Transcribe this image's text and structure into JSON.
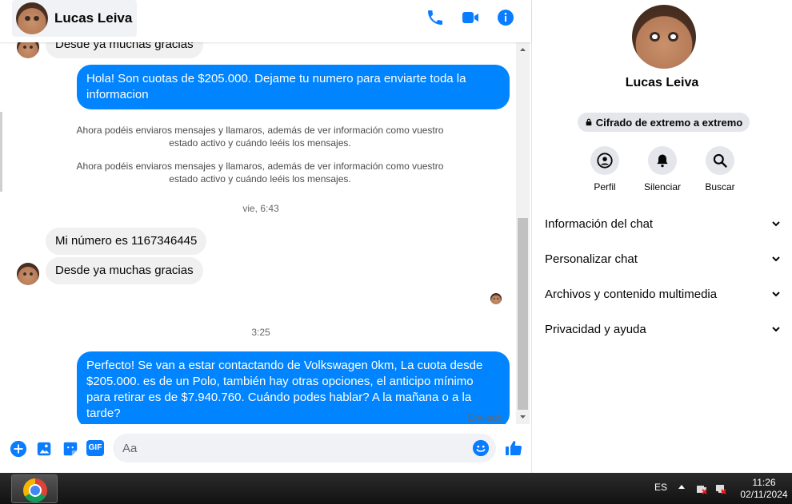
{
  "contact": {
    "name": "Lucas Leiva"
  },
  "header": {
    "icons": [
      "phone-icon",
      "video-call-icon",
      "info-icon"
    ]
  },
  "messages": {
    "partial_top": "Desde ya muchas gracias",
    "out_1": "Hola! Son cuotas de $205.000. Dejame tu numero para enviarte toda la informacion",
    "sys_1": "Ahora podéis enviaros mensajes y llamaros, además de ver información como vuestro estado activo y cuándo leéis los mensajes.",
    "sys_2": "Ahora podéis enviaros mensajes y llamaros, además de ver información como vuestro estado activo y cuándo leéis los mensajes.",
    "time_1": "vie, 6:43",
    "in_1": "Mi número es 1167346445",
    "in_2": "Desde ya muchas gracias",
    "time_2": "3:25",
    "out_2": "Perfecto!  Se van a estar contactando de Volkswagen 0km, La cuota desde $205.000. es de un Polo, también hay otras opciones, el anticipo mínimo para retirar es de $7.940.760. Cuándo podes hablar? A la mañana o a la tarde?",
    "status": "Enviado"
  },
  "composer": {
    "placeholder": "Aa",
    "gif_label": "GIF",
    "icons": [
      "plus-icon",
      "gallery-icon",
      "sticker-icon",
      "gif-icon",
      "emoji-icon",
      "thumbs-up-icon"
    ]
  },
  "info_panel": {
    "encryption": "Cifrado de extremo a extremo",
    "actions": [
      {
        "label": "Perfil",
        "icon": "profile-icon"
      },
      {
        "label": "Silenciar",
        "icon": "bell-icon"
      },
      {
        "label": "Buscar",
        "icon": "search-icon"
      }
    ],
    "sections": [
      "Información del chat",
      "Personalizar chat",
      "Archivos y contenido multimedia",
      "Privacidad y ayuda"
    ]
  },
  "taskbar": {
    "lang": "ES",
    "time": "11:26",
    "date": "02/11/2024"
  },
  "colors": {
    "accent": "#0084ff",
    "bubble_in": "#f0f0f0",
    "icon_blue": "#0a7cff"
  }
}
